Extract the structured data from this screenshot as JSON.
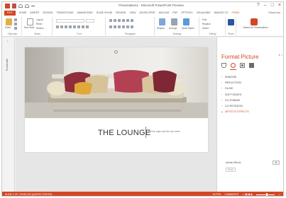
{
  "app": {
    "window_title": "Presentation1 - Microsoft PowerPoint Preview",
    "user_label": "Fiona Hou"
  },
  "tabs": [
    {
      "label": "FILE"
    },
    {
      "label": "HOME"
    },
    {
      "label": "INSERT"
    },
    {
      "label": "DESIGN"
    },
    {
      "label": "TRANSITIONS"
    },
    {
      "label": "ANIMATIONS"
    },
    {
      "label": "SLIDE SHOW"
    },
    {
      "label": "REVIEW"
    },
    {
      "label": "VIEW"
    },
    {
      "label": "DEVELOPER"
    },
    {
      "label": "ADD-INS"
    },
    {
      "label": "PDF"
    },
    {
      "label": "PPTPLEX"
    },
    {
      "label": "VISUALBEE"
    },
    {
      "label": "IMAGES TO"
    },
    {
      "label": "FORM"
    }
  ],
  "ribbon": {
    "groups": {
      "clipboard": "Clipboard",
      "slides": "Slides",
      "font": "Font",
      "paragraph": "Paragraph",
      "drawing": "Drawing",
      "editing": "Editing",
      "share": "Share"
    },
    "paste_label": "Paste",
    "new_slide_label": "New Slide",
    "layout_label": "Layout",
    "reset_label": "Reset",
    "section_label": "Section",
    "shapes_label": "Shapes",
    "arrange_label": "Arrange",
    "quick_styles_label": "Quick Styles",
    "find_label": "Find",
    "replace_label": "Replace",
    "select_label": "Select",
    "search_label": "Search for Presentations"
  },
  "thumbnails_label": "Thumbnails",
  "slide": {
    "title": "THE LOUNGE",
    "subtitle": "Where style and fun are meet"
  },
  "format_pane": {
    "title": "Format Picture",
    "sections": [
      {
        "label": "SHADOW",
        "open": false
      },
      {
        "label": "REFLECTION",
        "open": false
      },
      {
        "label": "GLOW",
        "open": false
      },
      {
        "label": "SOFT EDGES",
        "open": false
      },
      {
        "label": "3-D FORMAT",
        "open": false
      },
      {
        "label": "3-D ROTATION",
        "open": false
      },
      {
        "label": "ARTISTIC EFFECTS",
        "open": true
      }
    ],
    "artistic_effects_label": "Artistic Effects",
    "reset_label": "Reset"
  },
  "status": {
    "left": "SLIDE 1 OF 1   ENGLISH (UNITED STATES)",
    "notes": "NOTES",
    "comments": "COMMENTS"
  },
  "colors": {
    "accent": "#d24726"
  }
}
